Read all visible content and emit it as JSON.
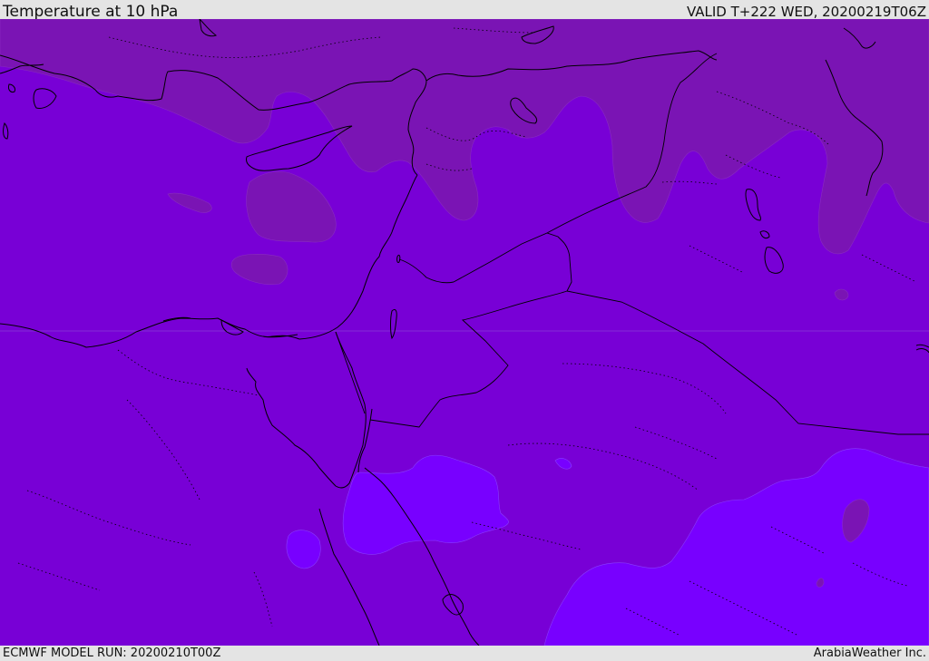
{
  "header": {
    "title": "Temperature at 10 hPa",
    "valid": "VALID T+222 WED, 20200219T06Z"
  },
  "footer": {
    "model_run": "ECMWF MODEL RUN: 20200210T00Z",
    "credit": "ArabiaWeather Inc."
  },
  "map": {
    "fill_colors": {
      "dark_band": "#7a14b4",
      "main_band": "#7800d6",
      "light_band": "#7800ff",
      "coast_line": "#000000"
    }
  }
}
